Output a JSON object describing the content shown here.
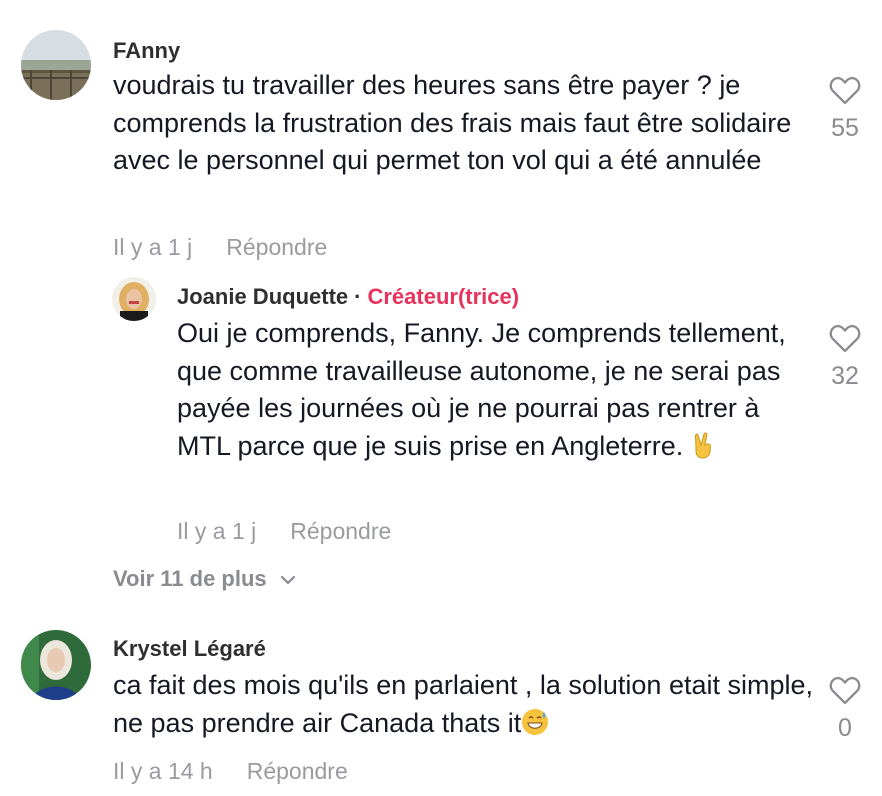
{
  "comments": [
    {
      "username": "FAnny",
      "text": "voudrais tu travailler des heures sans être payer ? je comprends la frustration des frais mais faut être solidaire avec le personnel qui permet ton vol qui a été annulée",
      "time": "Il y a 1 j",
      "reply_label": "Répondre",
      "likes": "55",
      "reply": {
        "username": "Joanie Duquette",
        "separator": "·",
        "badge": "Créateur(trice)",
        "text": "Oui je comprends, Fanny. Je comprends tellement, que comme travailleuse autonome, je ne serai pas payée les journées où je ne pourrai pas rentrer à MTL parce que je suis prise en Angleterre.",
        "time": "Il y a 1 j",
        "reply_label": "Répondre",
        "likes": "32",
        "emoji": "victory-hand-emoji"
      },
      "view_more": "Voir 11 de plus"
    },
    {
      "username": "Krystel Légaré",
      "text": "ca fait des mois qu'ils en parlaient , la solution etait simple, ne pas prendre air Canada thats it",
      "time": "Il y a 14 h",
      "reply_label": "Répondre",
      "likes": "0",
      "emoji": "grinning-sweat-emoji"
    }
  ],
  "icons": {
    "like": "heart-outline-icon",
    "expand": "chevron-down-icon"
  },
  "colors": {
    "creator_badge": "#e8325b",
    "meta_text": "#9a9ba0"
  }
}
